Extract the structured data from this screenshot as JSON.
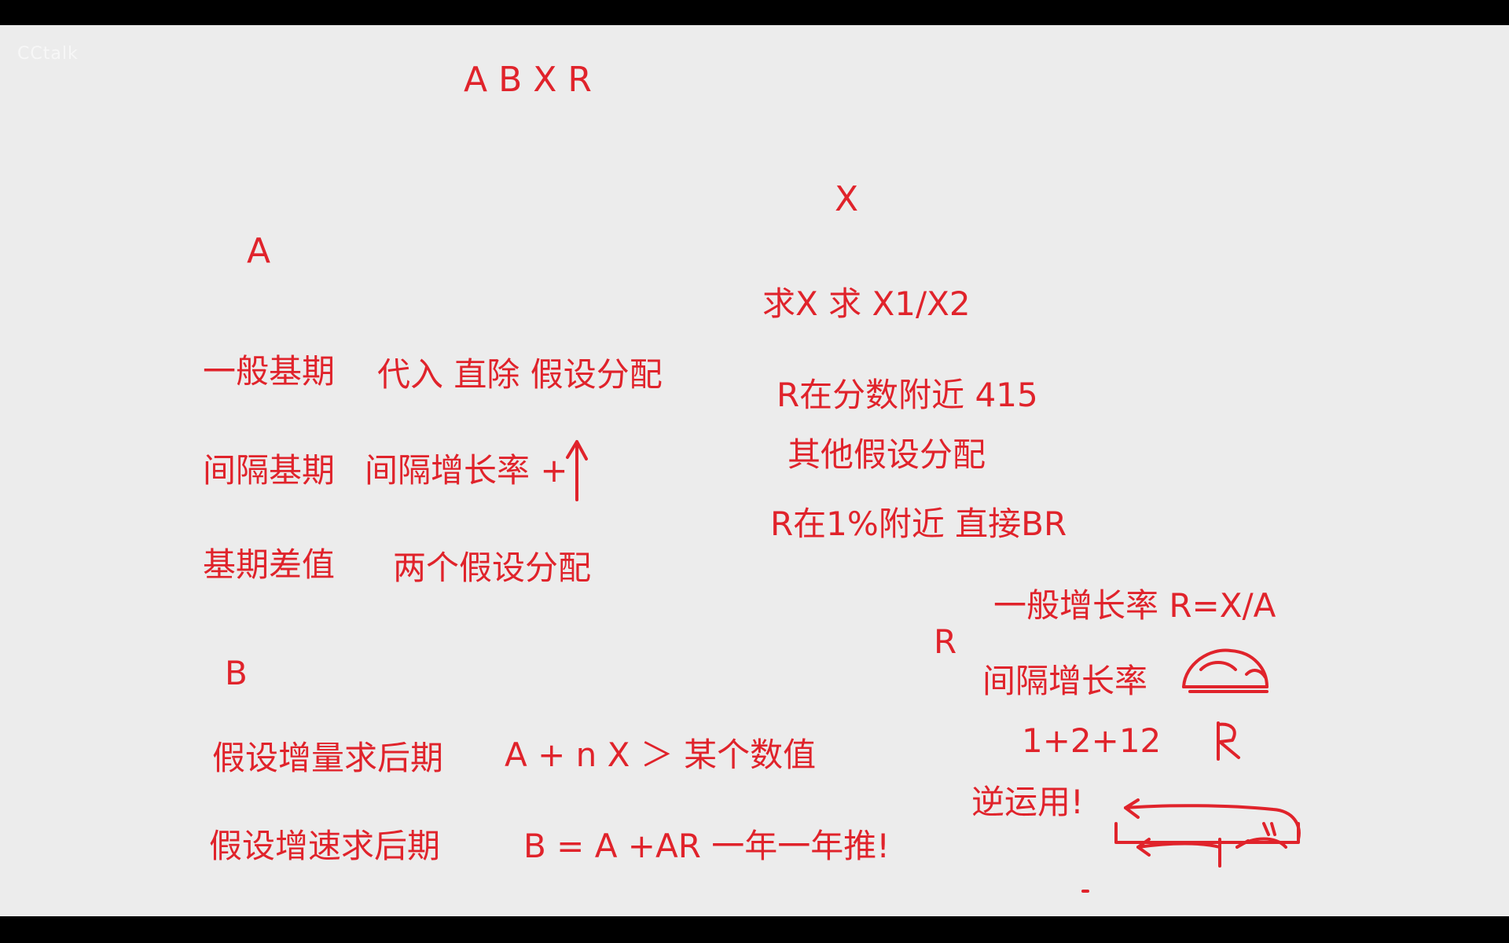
{
  "watermark": "CCtalk",
  "colors": {
    "ink": "#e0232b",
    "board": "#ececec",
    "frame": "#000000"
  },
  "header": {
    "letters": "A   B   X   R"
  },
  "section_a": {
    "heading": "A",
    "rows": [
      {
        "label": "一般基期",
        "note": "代入 直除 假设分配"
      },
      {
        "label": "间隔基期",
        "note": "间隔增长率 +"
      },
      {
        "label": "基期差值",
        "note": "两个假设分配"
      }
    ]
  },
  "section_b": {
    "heading": "B",
    "rows": [
      {
        "label": "假设增量求后期",
        "note": "A + n X ＞ 某个数值"
      },
      {
        "label": "假设增速求后期",
        "note": "B = A +AR   一年一年推!"
      }
    ]
  },
  "section_x": {
    "heading": "X",
    "line1": "求X    求 X1/X2",
    "line2": "R在分数附近 415",
    "line3": "其他假设分配",
    "line4": "R在1%附近 直接BR"
  },
  "section_r": {
    "heading": "R",
    "line1": "一般增长率   R=X/A",
    "line2": "间隔增长率",
    "line3": "1+2+12",
    "line4": "逆运用!"
  }
}
